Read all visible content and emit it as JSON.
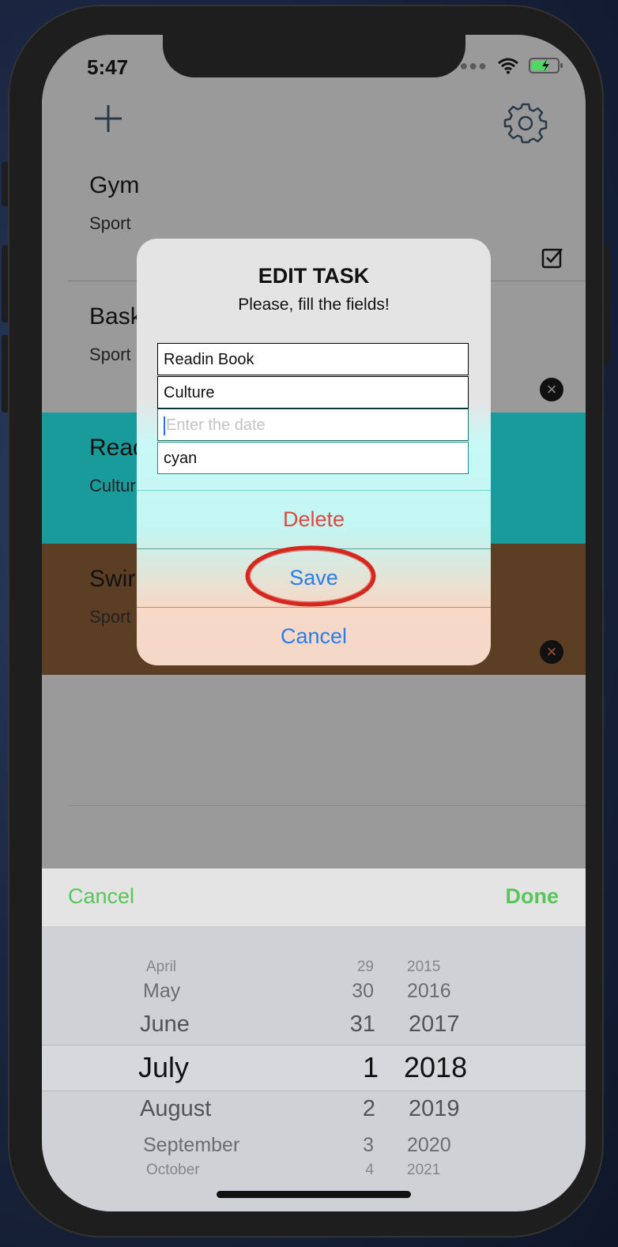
{
  "status": {
    "time": "5:47"
  },
  "tasks": [
    {
      "title": "Gym",
      "category": "Sport",
      "color": "#9a9a9a"
    },
    {
      "title": "Bask",
      "category": "Sport",
      "color": "#9a9a9a"
    },
    {
      "title": "Read",
      "category": "Cultur",
      "color": "#1a9b9b"
    },
    {
      "title": "Swir",
      "category": "Sport",
      "color": "#5c3e25"
    }
  ],
  "dialog": {
    "title": "EDIT TASK",
    "subtitle": "Please, fill the fields!",
    "name_value": "Readin Book",
    "category_value": "Culture",
    "date_placeholder": "Enter the date",
    "color_value": "cyan",
    "delete_label": "Delete",
    "save_label": "Save",
    "cancel_label": "Cancel"
  },
  "picker_toolbar": {
    "cancel_label": "Cancel",
    "done_label": "Done"
  },
  "picker": {
    "months": [
      "April",
      "May",
      "June",
      "July",
      "August",
      "September",
      "October"
    ],
    "days": [
      "29",
      "30",
      "31",
      "1",
      "2",
      "3",
      "4"
    ],
    "years": [
      "2015",
      "2016",
      "2017",
      "2018",
      "2019",
      "2020",
      "2021"
    ],
    "selected": {
      "month": "July",
      "day": "1",
      "year": "2018"
    }
  },
  "colors": {
    "accent_green": "#58c65a",
    "delete_red": "#e0473f",
    "link_blue": "#2b7de9"
  }
}
